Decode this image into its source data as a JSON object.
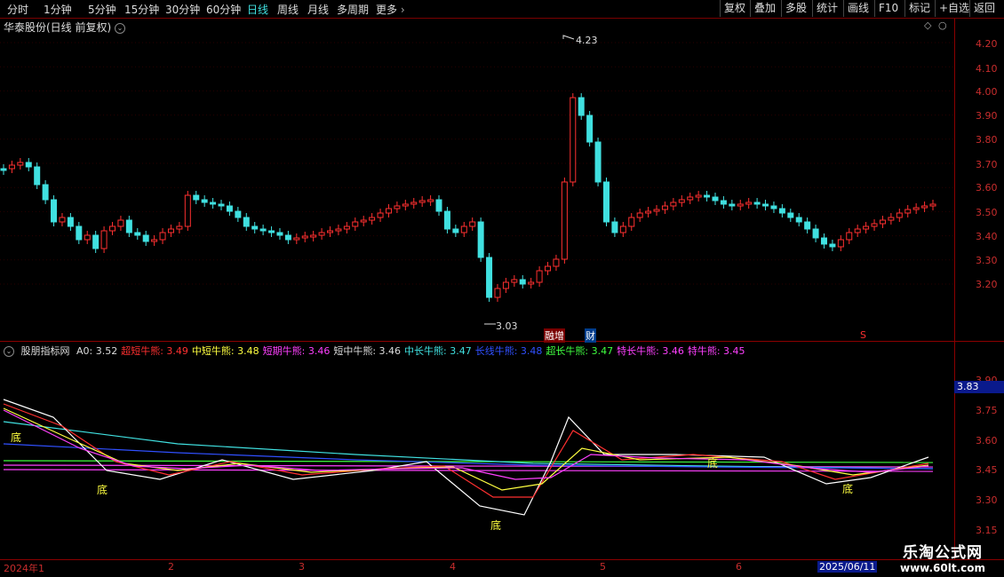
{
  "toolbar": {
    "periods": [
      "分时",
      "1分钟",
      "5分钟",
      "15分钟",
      "30分钟",
      "60分钟",
      "日线",
      "周线",
      "月线",
      "多周期",
      "更多"
    ],
    "active_period": "日线",
    "right": [
      "复权",
      "叠加",
      "多股",
      "统计",
      "画线",
      "F10",
      "标记",
      "+自选",
      "返回"
    ]
  },
  "stock": {
    "title": "华泰股份(日线 前复权)"
  },
  "price_axis": [
    "4.20",
    "4.10",
    "4.00",
    "3.90",
    "3.80",
    "3.70",
    "3.60",
    "3.50",
    "3.40",
    "3.30",
    "3.20"
  ],
  "annotations": {
    "high": "4.23",
    "low": "3.03",
    "flag1": "融增",
    "flag2": "财",
    "flag3": "S"
  },
  "indicator": {
    "name": "股朋指标网",
    "items": [
      {
        "label": "A0: 3.52",
        "color": "#dddddd"
      },
      {
        "label": "超短牛熊: 3.49",
        "color": "#ff3030"
      },
      {
        "label": "中短牛熊: 3.48",
        "color": "#ffff40"
      },
      {
        "label": "短期牛熊: 3.46",
        "color": "#ff40ff"
      },
      {
        "label": "短中牛熊: 3.46",
        "color": "#dddddd"
      },
      {
        "label": "中长牛熊: 3.47",
        "color": "#40e0e0"
      },
      {
        "label": "长线牛熊: 3.48",
        "color": "#3050ff"
      },
      {
        "label": "超长牛熊: 3.47",
        "color": "#40ff40"
      },
      {
        "label": "特长牛熊: 3.46",
        "color": "#ff40ff"
      },
      {
        "label": "特牛熊: 3.45",
        "color": "#ff40ff"
      }
    ],
    "axis": [
      "3.90",
      "3.75",
      "3.60",
      "3.45",
      "3.30",
      "3.15"
    ],
    "current": "3.83",
    "bottom_marker": "底"
  },
  "dates": [
    "2024年1",
    "2",
    "3",
    "4",
    "5",
    "6",
    "2025/06/11"
  ],
  "watermark": {
    "line1": "乐淘公式网",
    "line2": "www.60lt.com"
  },
  "colors": {
    "up": "#ff3030",
    "down": "#40e0e0",
    "axis": "#c82d2d"
  }
}
